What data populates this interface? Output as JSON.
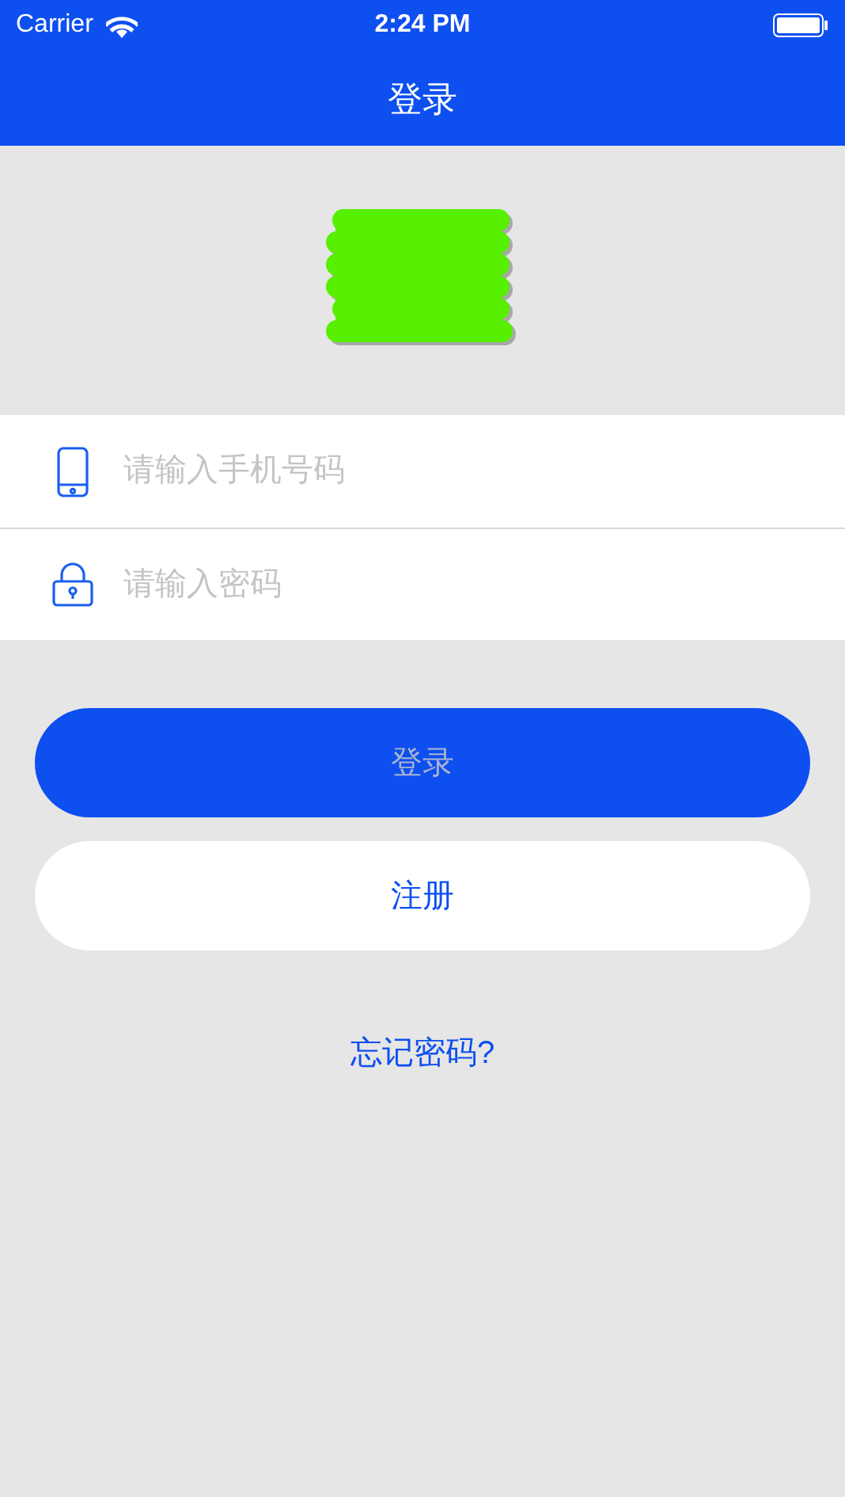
{
  "status_bar": {
    "carrier": "Carrier",
    "time": "2:24 PM"
  },
  "nav": {
    "title": "登录"
  },
  "fields": [
    {
      "kind": "phone",
      "placeholder": "请输入手机号码"
    },
    {
      "kind": "password",
      "placeholder": "请输入密码"
    }
  ],
  "buttons": [
    {
      "kind": "primary",
      "label": "登录",
      "disabled": true
    },
    {
      "kind": "secondary",
      "label": "注册",
      "disabled": false
    }
  ],
  "forgot_link": "忘记密码?"
}
